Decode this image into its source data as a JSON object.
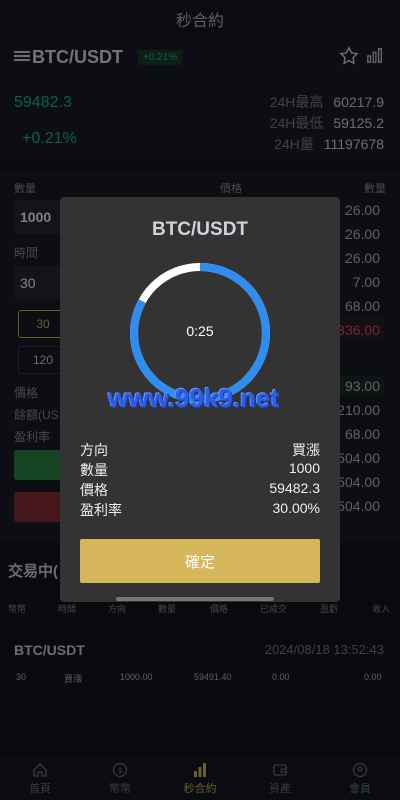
{
  "header": {
    "title": "秒合約"
  },
  "pair_bar": {
    "pair": "BTC/USDT",
    "change": "+0.21%",
    "icons": [
      "menu-icon",
      "star-icon",
      "kline-chart-icon"
    ]
  },
  "ticker": {
    "price": "59482.3",
    "change_pct": "+0.21%",
    "high_label": "24H最高",
    "high_value": "60217.9",
    "low_label": "24H最低",
    "low_value": "59125.2",
    "volume_label": "24H量",
    "volume_value": "11197678"
  },
  "order_form": {
    "quantity_label": "數量",
    "price_label": "價格",
    "quantity_col_label": "數量",
    "quantity_value": "1000",
    "time_label": "時間",
    "time_value": "30",
    "durations": [
      "30",
      "120"
    ],
    "stat_labels": [
      "價格",
      "餘額(US",
      "盈利率"
    ]
  },
  "order_book": {
    "asks": [
      "26.00",
      "26.00",
      "26.00",
      "7.00",
      "68.00",
      "336.00"
    ],
    "bids": [
      "93.00",
      "210.00",
      "68.00",
      "504.00",
      "504.00",
      "504.00"
    ]
  },
  "modal": {
    "pair": "BTC/USDT",
    "countdown": "0:25",
    "progress_remaining_fraction": 0.83,
    "watermark": "www.99k9.net",
    "rows": [
      {
        "label": "方向",
        "value": "買漲"
      },
      {
        "label": "數量",
        "value": "1000"
      },
      {
        "label": "價格",
        "value": "59482.3"
      },
      {
        "label": "盈利率",
        "value": "30.00%"
      }
    ],
    "confirm_label": "確定",
    "colors": {
      "ring": "#2f8cf0",
      "ring_track": "#ffffff",
      "confirm": "#d6b65a"
    }
  },
  "trades": {
    "title": "交易中(",
    "columns": [
      "幣幣",
      "時間",
      "方向",
      "數量",
      "價格",
      "已成交",
      "盈虧",
      "收入"
    ],
    "items": [
      {
        "pair": "BTC/USDT",
        "time": "2024/08/18 13:52:43",
        "duration": "30",
        "direction": "買漲",
        "amount": "1000.00",
        "price": "59491.40",
        "filled": "0.00",
        "pnl": "",
        "income": "0.00"
      }
    ]
  },
  "tabbar": {
    "tabs": [
      {
        "label": "首頁",
        "icon": "home-icon"
      },
      {
        "label": "幣幣",
        "icon": "coin-icon"
      },
      {
        "label": "秒合約",
        "icon": "bar-chart-icon"
      },
      {
        "label": "資產",
        "icon": "wallet-icon"
      },
      {
        "label": "會員",
        "icon": "user-icon"
      }
    ],
    "active_index": 2
  }
}
